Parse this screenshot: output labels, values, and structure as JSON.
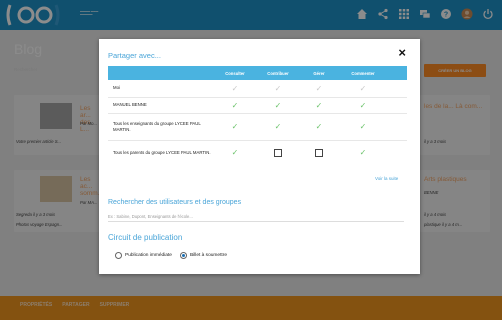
{
  "background": {
    "blog_title": "Blog",
    "search_label": "Rechercher",
    "create_button": "CRÉER UN BLOG",
    "cards": [
      {
        "title": "Les ar... des L...",
        "meta": "Par Mo...",
        "sub": "Votre premier article S..."
      },
      {
        "title": "Les ac... somm...",
        "meta": "Par MA...",
        "sub": "Segreda il y a 3 mois",
        "sub2": "Photos voyage Espagn..."
      },
      {
        "title": "les de la... Là com...",
        "meta": "il y a 3 mois",
        "sub": "..."
      },
      {
        "title": "Arts plastiques",
        "meta": "BENNE",
        "sub": "il y a 4 mois",
        "sub2": "plastique il y a 4 m..."
      }
    ],
    "bottom_links": [
      "PROPRIÉTÉS",
      "PARTAGER",
      "SUPPRIMER"
    ]
  },
  "modal": {
    "title": "Partager avec...",
    "close": "×",
    "columns": [
      "Consulter",
      "Contribuer",
      "Gérer",
      "Commenter"
    ],
    "rows": [
      {
        "name": "Moi",
        "perms": [
          "off",
          "off",
          "off",
          "off"
        ]
      },
      {
        "name": "MANUEL BENNE",
        "perms": [
          "on",
          "on",
          "on",
          "on"
        ]
      },
      {
        "name": "Tous les enseignants du groupe LYCEE PAUL MARTIN.",
        "perms": [
          "on",
          "on",
          "on",
          "on"
        ]
      },
      {
        "name": "Tous les parents du groupe LYCEE PAUL MARTIN.",
        "perms": [
          "on",
          "box",
          "box",
          "on"
        ]
      }
    ],
    "voir_suite": "Voir la suite",
    "search_heading": "Rechercher des utilisateurs et des groupes",
    "search_placeholder": "Ex : Sabine, Dupont, Enseignants de l'école...",
    "circuit_heading": "Circuit de publication",
    "radio_immediate": "Publication immédiate",
    "radio_submit": "Billet à soumettre",
    "selected": "submit"
  },
  "colors": {
    "topbar": "#1e93c8",
    "accent": "#4ab3e0",
    "orange": "#f1951e",
    "check_on": "#6cc36b"
  },
  "icons": [
    "home-icon",
    "share-icon",
    "apps-icon",
    "chat-icon",
    "help-icon",
    "user-icon",
    "power-icon"
  ]
}
